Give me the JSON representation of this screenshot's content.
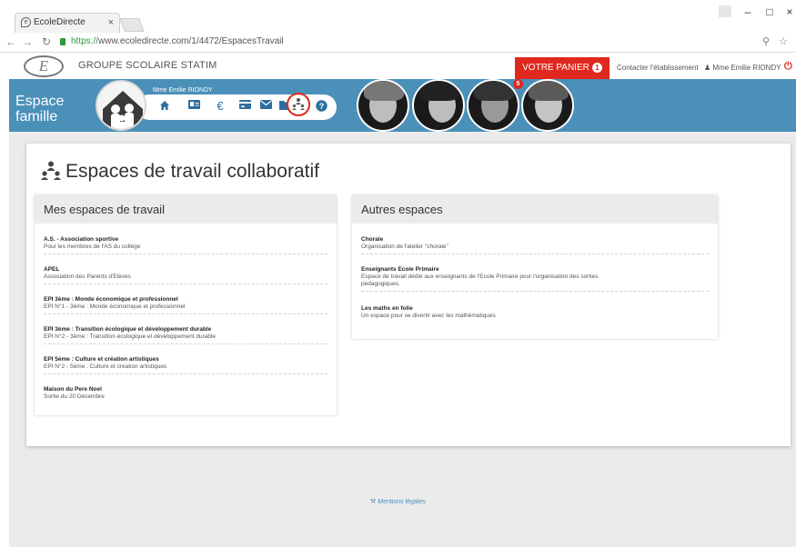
{
  "browser": {
    "tab_title": "EcoleDirecte",
    "url_scheme": "https://",
    "url_rest": "www.ecoledirecte.com/1/4472/EspacesTravail",
    "win_min": "–",
    "win_max": "□",
    "win_close": "×",
    "tab_close": "×"
  },
  "header": {
    "school_name": "GROUPE SCOLAIRE STATIM",
    "cart_label": "VOTRE PANIER",
    "cart_count": "1",
    "contact_label": "Contacter l'établissement",
    "user_name": "Mme Emilie RIONDY",
    "logo_letter": "E"
  },
  "banner": {
    "espace_line1": "Espace",
    "espace_line2": "famille",
    "parent_name": "Mme Emilie RIONDY",
    "kid_notification": "5",
    "nav_icons": [
      "home-icon",
      "id-card-icon",
      "euro-icon",
      "credit-card-icon",
      "envelope-icon",
      "folder-icon",
      "workspace-icon",
      "help-icon"
    ]
  },
  "page": {
    "title": "Espaces de travail collaboratif"
  },
  "mine": {
    "heading": "Mes espaces de travail",
    "items": [
      {
        "title": "A.S. - Association sportive",
        "desc": "Pour les membres de l'AS du collège"
      },
      {
        "title": "APEL",
        "desc": "Association des Parents d'Elèves"
      },
      {
        "title": "EPI 3ème : Monde économique et professionnel",
        "desc": "EPI N°1 - 3ème : Monde économique et professionnel"
      },
      {
        "title": "EPI 3ème : Transition écologique et développement durable",
        "desc": "EPI N°2 - 3ème : Transition écologique et développement durable"
      },
      {
        "title": "EPI 5ème : Culture et création artistiques",
        "desc": "EPI N°2 - 5ème : Culture et création artistiques"
      },
      {
        "title": "Maison du Pere Noel",
        "desc": "Sortie du 20 Décembre"
      }
    ]
  },
  "others": {
    "heading": "Autres espaces",
    "items": [
      {
        "title": "Chorale",
        "desc": "Organisation de l'atelier \"chorale\""
      },
      {
        "title": "Enseignants Ecole Primaire",
        "desc": "Espace de travail dédié aux enseignants de l'Ecole Primaire pour l'organisation des sorties pédagogiques."
      },
      {
        "title": "Les maths en folie",
        "desc": "Un espace pour se divertir avec les mathématiques"
      }
    ]
  },
  "footer": {
    "legal": "Mentions légales"
  },
  "colors": {
    "banner_blue": "#4a90b8",
    "accent_red": "#e0281e",
    "icon_blue": "#2e6f9e"
  }
}
